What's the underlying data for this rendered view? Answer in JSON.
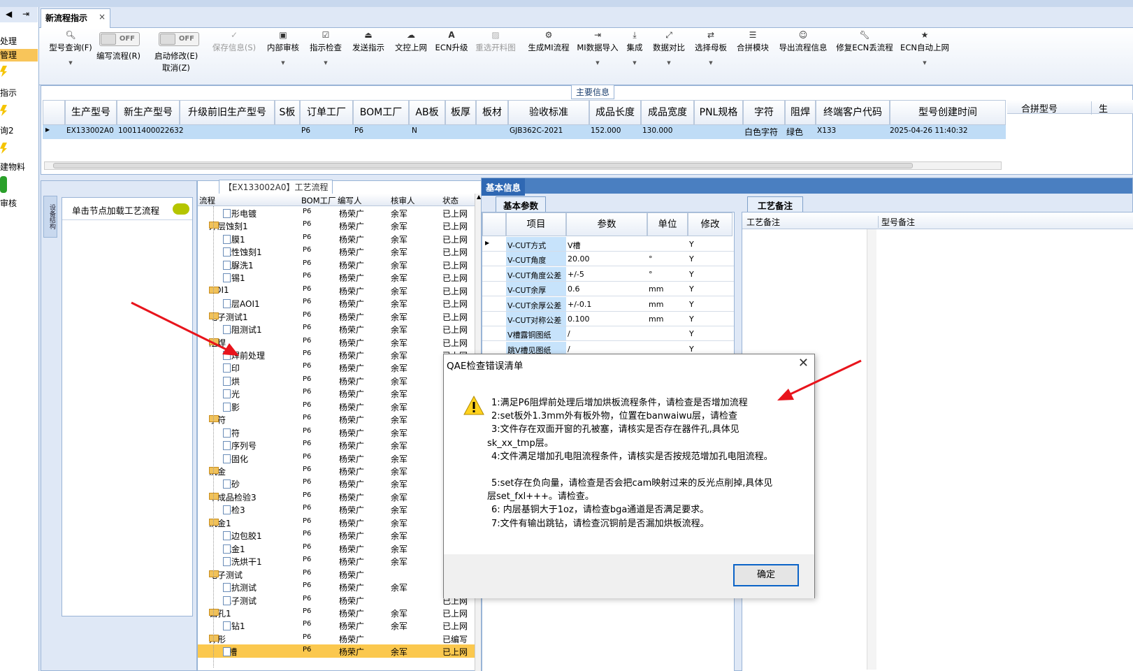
{
  "left_nav": {
    "items": [
      "处理",
      "管理",
      "指示",
      "询2",
      "建物料",
      "审核"
    ]
  },
  "tab": {
    "title": "新流程指示",
    "close": "×"
  },
  "toolbar": {
    "buttons": [
      {
        "label": "型号查询(F)",
        "icon": "search-icon"
      },
      {
        "label": "保存信息(S)",
        "icon": "check-icon"
      },
      {
        "label": "内部审核",
        "icon": "print-icon"
      },
      {
        "label": "指示检查",
        "icon": "checkbox-icon"
      },
      {
        "label": "发送指示",
        "icon": "upload-icon"
      },
      {
        "label": "文控上网",
        "icon": "cloud-icon"
      },
      {
        "label": "ECN升级",
        "icon": "ecn-icon"
      },
      {
        "label": "重选开料图",
        "icon": "image-icon"
      },
      {
        "label": "生成MI流程",
        "icon": "gears-icon"
      },
      {
        "label": "MI数据导入",
        "icon": "import-icon"
      },
      {
        "label": "集成",
        "icon": "download-icon"
      },
      {
        "label": "数据对比",
        "icon": "compare-icon"
      },
      {
        "label": "选择母板",
        "icon": "shuffle-icon"
      },
      {
        "label": "合拼模块",
        "icon": "list-icon"
      },
      {
        "label": "导出流程信息",
        "icon": "smile-icon"
      },
      {
        "label": "修复ECN丢流程",
        "icon": "wrench-icon"
      },
      {
        "label": "ECN自动上网",
        "icon": "star-icon"
      }
    ],
    "toggles": [
      {
        "state": "OFF",
        "label": "编写流程(R)"
      },
      {
        "state": "OFF",
        "label": "启动修改(E)",
        "sub": "取消(Z)"
      }
    ]
  },
  "main_info": {
    "title": "主要信息",
    "columns": [
      "生产型号",
      "新生产型号",
      "升级前旧生产型号",
      "S板",
      "订单工厂",
      "BOM工厂",
      "AB板",
      "板厚",
      "板材",
      "验收标准",
      "成品长度",
      "成品宽度",
      "PNL规格",
      "字符",
      "阻焊",
      "终端客户代码",
      "型号创建时间"
    ],
    "row": [
      "EX133002A0",
      "10011400022632",
      "",
      "",
      "P6",
      "P6",
      "N",
      "",
      "",
      "GJB362C-2021",
      "152.000",
      "130.000",
      "",
      "白色字符",
      "绿色",
      "X133",
      "2025-04-26 11:40:32"
    ],
    "right_columns": [
      "合拼型号",
      "生"
    ]
  },
  "node_panel": {
    "vertical_tab": "设备结构",
    "hint": "单击节点加载工艺流程"
  },
  "process_tree": {
    "title": "【EX133002A0】工艺流程",
    "columns": [
      "流程",
      "BOM工厂",
      "编写人",
      "核审人",
      "状态"
    ],
    "rows": [
      {
        "level": 2,
        "type": "doc",
        "name": "图形电镀",
        "bom": "P6",
        "writer": "杨荣广",
        "reviewer": "余军",
        "status": "已上网"
      },
      {
        "level": 1,
        "type": "folder",
        "name": "外层蚀刻1",
        "bom": "P6",
        "writer": "杨荣广",
        "reviewer": "余军",
        "status": "已上网"
      },
      {
        "level": 2,
        "type": "doc",
        "name": "退膜1",
        "bom": "P6",
        "writer": "杨荣广",
        "reviewer": "余军",
        "status": "已上网"
      },
      {
        "level": 2,
        "type": "doc",
        "name": "碱性蚀刻1",
        "bom": "P6",
        "writer": "杨荣广",
        "reviewer": "余军",
        "status": "已上网"
      },
      {
        "level": 2,
        "type": "doc",
        "name": "硫脲洗1",
        "bom": "P6",
        "writer": "杨荣广",
        "reviewer": "余军",
        "status": "已上网"
      },
      {
        "level": 2,
        "type": "doc",
        "name": "退锡1",
        "bom": "P6",
        "writer": "杨荣广",
        "reviewer": "余军",
        "status": "已上网"
      },
      {
        "level": 1,
        "type": "folder",
        "name": "AOI1",
        "bom": "P6",
        "writer": "杨荣广",
        "reviewer": "余军",
        "status": "已上网"
      },
      {
        "level": 2,
        "type": "doc",
        "name": "外层AOI1",
        "bom": "P6",
        "writer": "杨荣广",
        "reviewer": "余军",
        "status": "已上网"
      },
      {
        "level": 1,
        "type": "folder",
        "name": "电子测试1",
        "bom": "P6",
        "writer": "杨荣广",
        "reviewer": "余军",
        "status": "已上网"
      },
      {
        "level": 2,
        "type": "doc",
        "name": "低阻测试1",
        "bom": "P6",
        "writer": "杨荣广",
        "reviewer": "余军",
        "status": "已上网"
      },
      {
        "level": 1,
        "type": "folder",
        "name": "阻焊",
        "bom": "P6",
        "writer": "杨荣广",
        "reviewer": "余军",
        "status": "已上网"
      },
      {
        "level": 2,
        "type": "doc",
        "name": "阻焊前处理",
        "bom": "P6",
        "writer": "杨荣广",
        "reviewer": "余军",
        "status": "已上网"
      },
      {
        "level": 2,
        "type": "doc",
        "name": "丝印",
        "bom": "P6",
        "writer": "杨荣广",
        "reviewer": "余军",
        "status": "已上网"
      },
      {
        "level": 2,
        "type": "doc",
        "name": "预烘",
        "bom": "P6",
        "writer": "杨荣广",
        "reviewer": "余军",
        "status": "已上网"
      },
      {
        "level": 2,
        "type": "doc",
        "name": "曝光",
        "bom": "P6",
        "writer": "杨荣广",
        "reviewer": "余军",
        "status": "已上网"
      },
      {
        "level": 2,
        "type": "doc",
        "name": "显影",
        "bom": "P6",
        "writer": "杨荣广",
        "reviewer": "余军",
        "status": "已上网"
      },
      {
        "level": 1,
        "type": "folder",
        "name": "字符",
        "bom": "P6",
        "writer": "杨荣广",
        "reviewer": "余军",
        "status": "已上网"
      },
      {
        "level": 2,
        "type": "doc",
        "name": "字符",
        "bom": "P6",
        "writer": "杨荣广",
        "reviewer": "余军",
        "status": "已上网"
      },
      {
        "level": 2,
        "type": "doc",
        "name": "印序列号",
        "bom": "P6",
        "writer": "杨荣广",
        "reviewer": "余军",
        "status": "已上网"
      },
      {
        "level": 2,
        "type": "doc",
        "name": "终固化",
        "bom": "P6",
        "writer": "杨荣广",
        "reviewer": "余军",
        "status": "已上网"
      },
      {
        "level": 1,
        "type": "folder",
        "name": "沉金",
        "bom": "P6",
        "writer": "杨荣广",
        "reviewer": "余军",
        "status": "已上网"
      },
      {
        "level": 2,
        "type": "doc",
        "name": "喷砂",
        "bom": "P6",
        "writer": "杨荣广",
        "reviewer": "余军",
        "status": "已上网"
      },
      {
        "level": 1,
        "type": "folder",
        "name": "半成品检验3",
        "bom": "P6",
        "writer": "杨荣广",
        "reviewer": "余军",
        "status": "已上网"
      },
      {
        "level": 2,
        "type": "doc",
        "name": "半检3",
        "bom": "P6",
        "writer": "杨荣广",
        "reviewer": "余军",
        "status": "已上网"
      },
      {
        "level": 1,
        "type": "folder",
        "name": "沉金1",
        "bom": "P6",
        "writer": "杨荣广",
        "reviewer": "余军",
        "status": "已上网"
      },
      {
        "level": 2,
        "type": "doc",
        "name": "板边包胶1",
        "bom": "P6",
        "writer": "杨荣广",
        "reviewer": "余军",
        "status": "已上网"
      },
      {
        "level": 2,
        "type": "doc",
        "name": "沉金1",
        "bom": "P6",
        "writer": "杨荣广",
        "reviewer": "余军",
        "status": "已上网"
      },
      {
        "level": 2,
        "type": "doc",
        "name": "水洗烘干1",
        "bom": "P6",
        "writer": "杨荣广",
        "reviewer": "余军",
        "status": "已上网"
      },
      {
        "level": 1,
        "type": "folder",
        "name": "电子测试",
        "bom": "P6",
        "writer": "杨荣广",
        "reviewer": "",
        "status": "已上网"
      },
      {
        "level": 2,
        "type": "doc",
        "name": "阻抗测试",
        "bom": "P6",
        "writer": "杨荣广",
        "reviewer": "余军",
        "status": "已上网"
      },
      {
        "level": 2,
        "type": "doc",
        "name": "电子测试",
        "bom": "P6",
        "writer": "杨荣广",
        "reviewer": "",
        "status": "已上网"
      },
      {
        "level": 1,
        "type": "folder",
        "name": "钻孔1",
        "bom": "P6",
        "writer": "杨荣广",
        "reviewer": "余军",
        "status": "已上网"
      },
      {
        "level": 2,
        "type": "doc",
        "name": "二钻1",
        "bom": "P6",
        "writer": "杨荣广",
        "reviewer": "余军",
        "status": "已上网"
      },
      {
        "level": 1,
        "type": "folder",
        "name": "外形",
        "bom": "P6",
        "writer": "杨荣广",
        "reviewer": "",
        "status": "已编写"
      },
      {
        "level": 2,
        "type": "doc",
        "name": "V槽",
        "bom": "P6",
        "writer": "杨荣广",
        "reviewer": "余军",
        "status": "已上网",
        "selected": true
      }
    ]
  },
  "basic_info": {
    "tab": "基本信息",
    "param_tab": "基本参数",
    "columns": [
      "项目",
      "参数",
      "单位",
      "修改"
    ],
    "rows": [
      [
        "V-CUT方式",
        "V槽",
        "",
        "Y"
      ],
      [
        "V-CUT角度",
        "20.00",
        "°",
        "Y"
      ],
      [
        "V-CUT角度公差",
        "+/-5",
        "°",
        "Y"
      ],
      [
        "V-CUT余厚",
        "0.6",
        "mm",
        "Y"
      ],
      [
        "V-CUT余厚公差",
        "+/-0.1",
        "mm",
        "Y"
      ],
      [
        "V-CUT对称公差",
        "0.100",
        "mm",
        "Y"
      ],
      [
        "V槽露铜图纸",
        "/",
        "",
        "Y"
      ],
      [
        "跳V槽见图纸",
        "/",
        "",
        "Y"
      ]
    ],
    "memo_tab": "工艺备注",
    "memo_columns": [
      "工艺备注",
      "型号备注"
    ]
  },
  "dialog": {
    "title": "QAE检查错误清单",
    "close": "✕",
    "lines": [
      "1:满足P6阻焊前处理后增加烘板流程条件，请检查是否增加流程",
      "2:set板外1.3mm外有板外物，位置在banwaiwu层，请检查",
      "3:文件存在双面开窗的孔被塞，请核实是否存在器件孔,具体见",
      "sk_xx_tmp层。",
      "4:文件满足增加孔电阻流程条件，请核实是否按规范增加孔电阻流程。",
      "",
      "5:set存在负向量，请检查是否会把cam映射过来的反光点削掉,具体见",
      "层set_fxl+++。请检查。",
      "6: 内层基铜大于1oz，请检查bga通道是否满足要求。",
      "7:文件有输出跳钻，请检查沉铜前是否漏加烘板流程。"
    ],
    "ok_label": "确定"
  }
}
